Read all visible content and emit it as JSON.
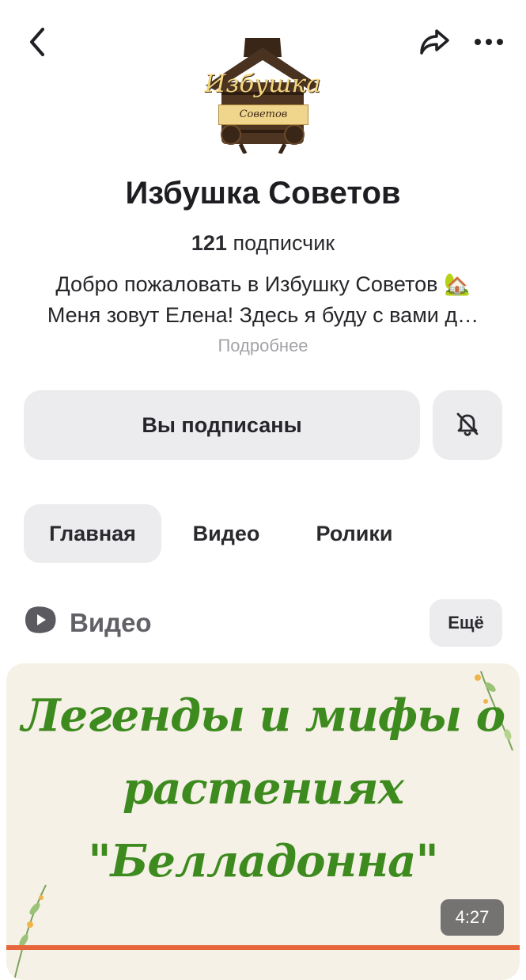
{
  "channel": {
    "name": "Избушка Советов",
    "subscribers_count": "121",
    "subscribers_label": "подписчик",
    "description_line1": "Добро пожаловать в Избушку Советов",
    "description_line1_emoji": "🏡",
    "description_line2": "Меня зовут Елена! Здесь я буду с вами д…",
    "more_label": "Подробнее"
  },
  "logo": {
    "title": "Избушка",
    "ribbon": "Советов"
  },
  "actions": {
    "subscribed_label": "Вы подписаны",
    "bell_icon": "bell-off-icon"
  },
  "tabs": [
    {
      "label": "Главная",
      "active": true
    },
    {
      "label": "Видео",
      "active": false
    },
    {
      "label": "Ролики",
      "active": false
    }
  ],
  "section": {
    "title": "Видео",
    "more_label": "Ещё"
  },
  "video": {
    "thumb_line1": "Легенды и мифы о",
    "thumb_line2": "растениях",
    "thumb_line3": "\"Белладонна\"",
    "duration": "4:27"
  },
  "colors": {
    "accent": "#e8663b",
    "button_bg": "#ececef",
    "thumb_text": "#3d8a1f"
  }
}
